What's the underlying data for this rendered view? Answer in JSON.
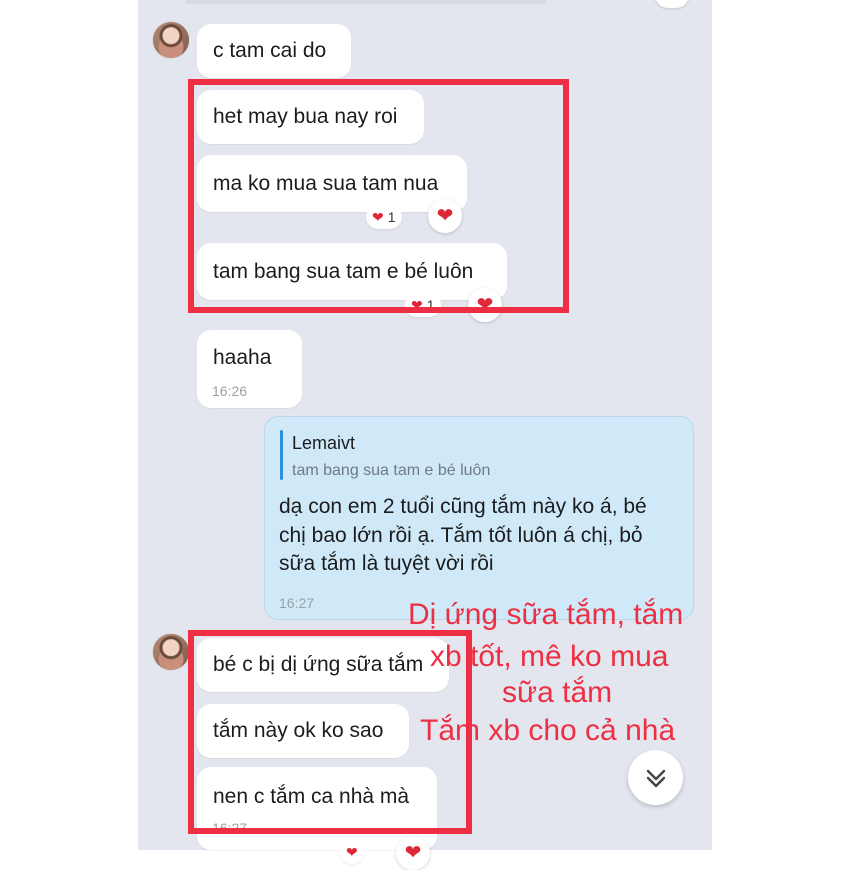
{
  "messages": [
    {
      "text": "c tam cai do"
    },
    {
      "text": "het may bua nay roi"
    },
    {
      "text": "ma ko mua sua tam nua"
    },
    {
      "text": "tam bang sua tam e bé luôn"
    },
    {
      "text": "haaha"
    },
    {
      "text": "bé c bị dị ứng sữa tắm"
    },
    {
      "text": "tắm này ok ko sao"
    },
    {
      "text": "nen c tắm ca nhà mà"
    }
  ],
  "reactions": {
    "heart_count_1": "1",
    "heart_count_2": "1",
    "heart_icon": "❤"
  },
  "timestamps": {
    "haaha": "16:26",
    "reply": "16:27",
    "last": "16:27"
  },
  "reply_message": {
    "quoted_name": "Lemaivt",
    "quoted_text": "tam bang sua tam e bé luôn",
    "lines": [
      "dạ con em 2 tuổi cũng tắm này ko á, bé",
      "chị bao lớn rồi ạ. Tắm tốt luôn á chị, bỏ",
      "sữa tắm là tuyệt vời rồi"
    ]
  },
  "annotation": {
    "lines": [
      "Dị ứng sữa tắm, tắm",
      "xb tốt, mê ko mua",
      "sữa tắm",
      "Tắm xb cho cả nhà"
    ],
    "color": "#ee2f43"
  },
  "colors": {
    "chat_bg": "#e3e6ee",
    "reply_bg": "#cfe9f9",
    "accent": "#2f8fd6"
  },
  "icons": {
    "scroll_down": "chevron-double-down-icon",
    "avatar": "user-avatar",
    "heart": "heart-icon"
  }
}
